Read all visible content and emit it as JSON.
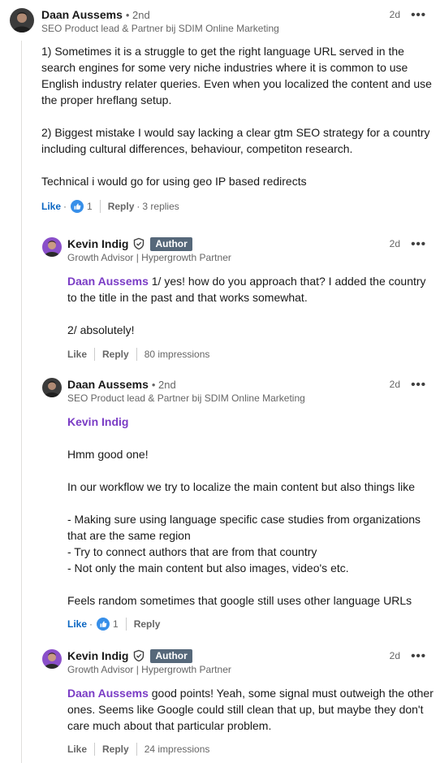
{
  "comments": [
    {
      "author": "Daan Aussems",
      "degree": "• 2nd",
      "headline": "SEO Product lead & Partner bij SDIM Online Marketing",
      "time": "2d",
      "body": "1) Sometimes it is a struggle to get the right language URL served in the search engines for some very niche industries where it is common to use English industry relater queries. Even when you localized the content and use the proper hreflang setup.\n\n2) Biggest mistake I would say lacking a clear gtm SEO strategy for a country including cultural differences, behaviour, competiton research.\n\nTechnical i would go for using geo IP based redirects",
      "like_label": "Like",
      "reaction_count": "1",
      "reply_label": "Reply",
      "replies_label": "3 replies"
    },
    {
      "author": "Kevin Indig",
      "author_badge": "Author",
      "headline": "Growth Advisor | Hypergrowth Partner",
      "time": "2d",
      "mention": "Daan Aussems",
      "body": "1/ yes! how do you approach that? I added the country to the title in the past and that works somewhat.\n\n2/ absolutely!",
      "like_label": "Like",
      "reply_label": "Reply",
      "impressions": "80 impressions"
    },
    {
      "author": "Daan Aussems",
      "degree": "• 2nd",
      "headline": "SEO Product lead & Partner bij SDIM Online Marketing",
      "time": "2d",
      "mention": "Kevin Indig",
      "body": "Hmm good one!\n\nIn our workflow we try to localize the main content but also things like\n\n- Making sure using language specific case studies from organizations that are the same region\n- Try to connect authors that are from that country\n- Not only the main content but also images, video's etc.\n\nFeels random sometimes that google still uses other language URLs",
      "like_label": "Like",
      "reaction_count": "1",
      "reply_label": "Reply"
    },
    {
      "author": "Kevin Indig",
      "author_badge": "Author",
      "headline": "Growth Advisor | Hypergrowth Partner",
      "time": "2d",
      "mention": "Daan Aussems",
      "body": "good points! Yeah, some signal must outweigh the other ones. Seems like Google could still clean that up, but maybe they don't care much about that particular problem.",
      "like_label": "Like",
      "reply_label": "Reply",
      "impressions": "24 impressions"
    }
  ],
  "ui": {
    "more_glyph": "•••",
    "action_dot": "·"
  },
  "colors": {
    "link_blue": "#0a66c2",
    "mention_purple": "#7a3cc5",
    "author_badge_bg": "#56687a",
    "muted_text": "#666666"
  }
}
